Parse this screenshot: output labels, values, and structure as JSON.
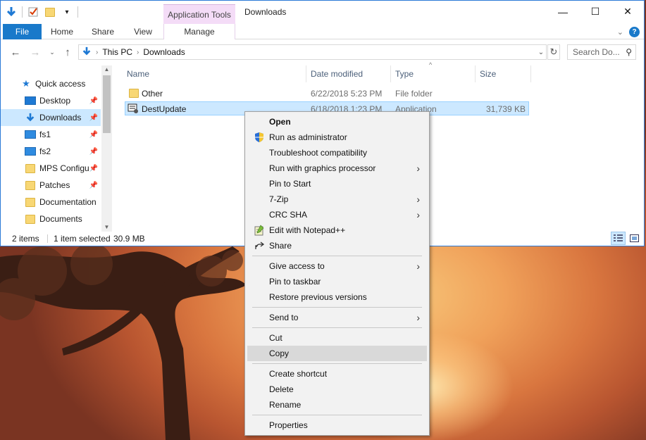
{
  "window": {
    "title": "Downloads",
    "context_tab_group": "Application Tools",
    "caption": {
      "minimize": "—",
      "maximize": "☐",
      "close": "✕"
    }
  },
  "ribbon": {
    "tabs": [
      "File",
      "Home",
      "Share",
      "View",
      "Manage"
    ]
  },
  "address": {
    "crumbs": [
      "This PC",
      "Downloads"
    ],
    "search_placeholder": "Search Do..."
  },
  "nav": {
    "items": [
      {
        "label": "Quick access",
        "icon": "star-icon",
        "pinned": false
      },
      {
        "label": "Desktop",
        "icon": "desktop-icon",
        "pinned": true
      },
      {
        "label": "Downloads",
        "icon": "download-icon",
        "pinned": true
      },
      {
        "label": "fs1",
        "icon": "monitor-icon",
        "pinned": true
      },
      {
        "label": "fs2",
        "icon": "monitor-icon",
        "pinned": true
      },
      {
        "label": "MPS Configu",
        "icon": "folder-icon",
        "pinned": true
      },
      {
        "label": "Patches",
        "icon": "folder-icon",
        "pinned": true
      },
      {
        "label": "Documentation",
        "icon": "folder-icon",
        "pinned": false
      },
      {
        "label": "Documents",
        "icon": "folder-icon",
        "pinned": false
      }
    ]
  },
  "filelist": {
    "columns": [
      "Name",
      "Date modified",
      "Type",
      "Size"
    ],
    "rows": [
      {
        "name": "Other",
        "date": "6/22/2018 5:23 PM",
        "type": "File folder",
        "size": "",
        "icon": "folder-icon"
      },
      {
        "name": "DestUpdate",
        "date": "6/18/2018 1:23 PM",
        "type": "Application",
        "size": "31,739 KB",
        "icon": "application-icon"
      }
    ]
  },
  "status": {
    "items": "2 items",
    "selected": "1 item selected",
    "size": "30.9 MB"
  },
  "context_menu": {
    "groups": [
      [
        {
          "label": "Open",
          "bold": true
        },
        {
          "label": "Run as administrator",
          "icon": "uac-shield-icon"
        },
        {
          "label": "Troubleshoot compatibility"
        },
        {
          "label": "Run with graphics processor",
          "submenu": true
        },
        {
          "label": "Pin to Start"
        },
        {
          "label": "7-Zip",
          "submenu": true
        },
        {
          "label": "CRC SHA",
          "submenu": true
        },
        {
          "label": "Edit with Notepad++",
          "icon": "notepad-plus-icon"
        },
        {
          "label": "Share",
          "icon": "share-icon"
        }
      ],
      [
        {
          "label": "Give access to",
          "submenu": true
        },
        {
          "label": "Pin to taskbar"
        },
        {
          "label": "Restore previous versions"
        }
      ],
      [
        {
          "label": "Send to",
          "submenu": true
        }
      ],
      [
        {
          "label": "Cut"
        },
        {
          "label": "Copy",
          "highlighted": true
        }
      ],
      [
        {
          "label": "Create shortcut"
        },
        {
          "label": "Delete"
        },
        {
          "label": "Rename"
        }
      ],
      [
        {
          "label": "Properties"
        }
      ]
    ]
  },
  "colors": {
    "accent": "#1979ca",
    "selection": "#cce8ff",
    "context_tab": "#f4dcf7"
  }
}
